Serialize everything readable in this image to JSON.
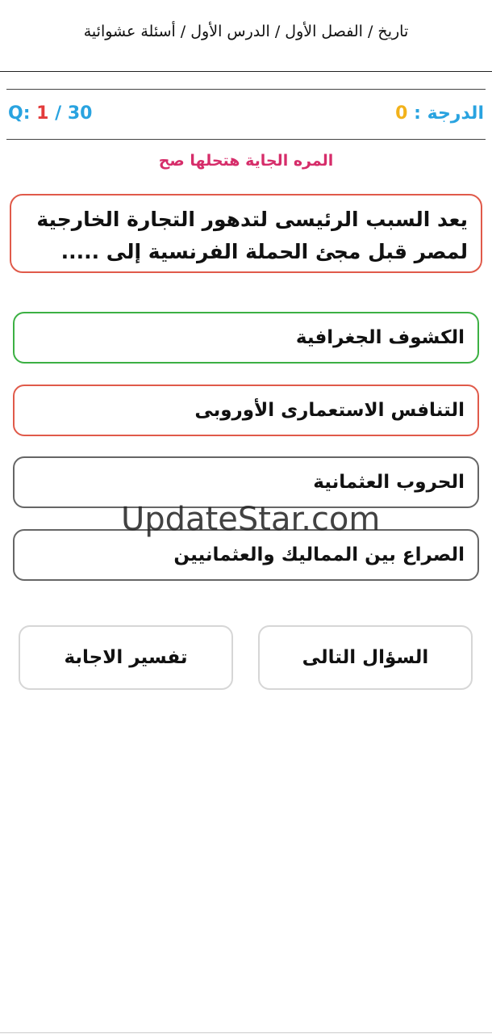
{
  "breadcrumb": "تاريخ / الفصل الأول / الدرس الأول / أسئلة عشوائية",
  "score": {
    "label": "الدرجة :",
    "value": "0"
  },
  "question_counter": {
    "prefix": "Q:",
    "current": "1",
    "separator": "/",
    "total": "30"
  },
  "feedback": "المره الجاية هتحلها صح",
  "question": "يعد السبب الرئيسى لتدهور التجارة الخارجية لمصر قبل مجئ الحملة الفرنسية إلى .....",
  "options": [
    {
      "label": "الكشوف الجغرافية",
      "state": "correct"
    },
    {
      "label": "التنافس الاستعمارى الأوروبى",
      "state": "wrong"
    },
    {
      "label": "الحروب العثمانية",
      "state": "neutral"
    },
    {
      "label": "الصراع بين المماليك والعثمانيين",
      "state": "neutral"
    }
  ],
  "buttons": {
    "next": "السؤال التالى",
    "explain": "تفسير الاجابة"
  },
  "watermark": "UpdateStar.com",
  "colors": {
    "correct": "#3cb043",
    "wrong": "#e05a4a",
    "accent": "#29a3e0",
    "score": "#f2b21b",
    "feedback": "#d62d6a"
  }
}
